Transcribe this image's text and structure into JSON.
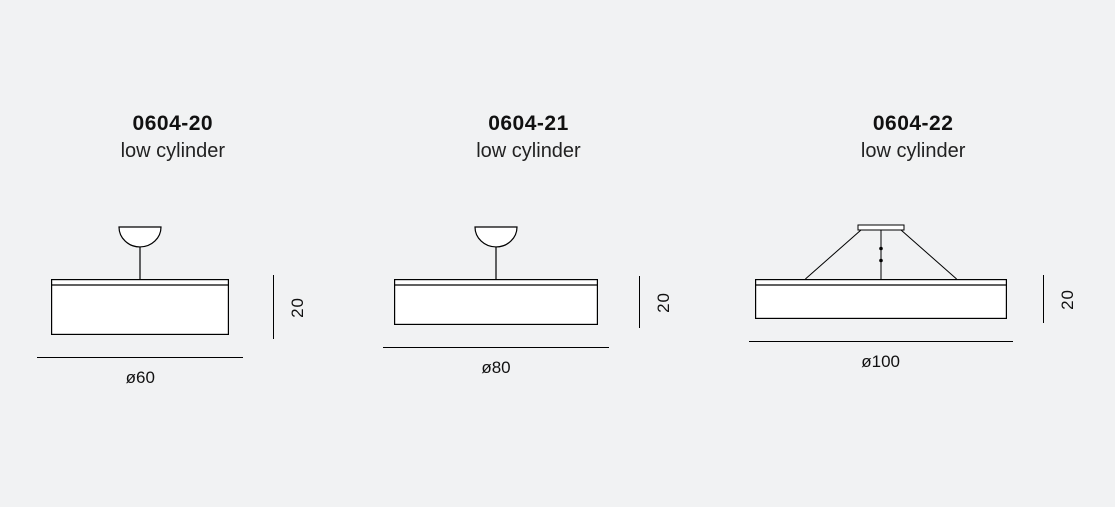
{
  "variants": [
    {
      "code": "0604-20",
      "desc": "low cylinder",
      "diameter_label": "ø60",
      "height_label": "20",
      "px": {
        "shade_w": 178,
        "shade_h": 56,
        "v_h": 64,
        "rule_w": 206,
        "mount": "single"
      }
    },
    {
      "code": "0604-21",
      "desc": "low cylinder",
      "diameter_label": "ø80",
      "height_label": "20",
      "px": {
        "shade_w": 204,
        "shade_h": 46,
        "v_h": 52,
        "rule_w": 226,
        "mount": "single"
      }
    },
    {
      "code": "0604-22",
      "desc": "low cylinder",
      "diameter_label": "ø100",
      "height_label": "20",
      "px": {
        "shade_w": 252,
        "shade_h": 40,
        "v_h": 48,
        "rule_w": 264,
        "mount": "tripod"
      }
    }
  ]
}
